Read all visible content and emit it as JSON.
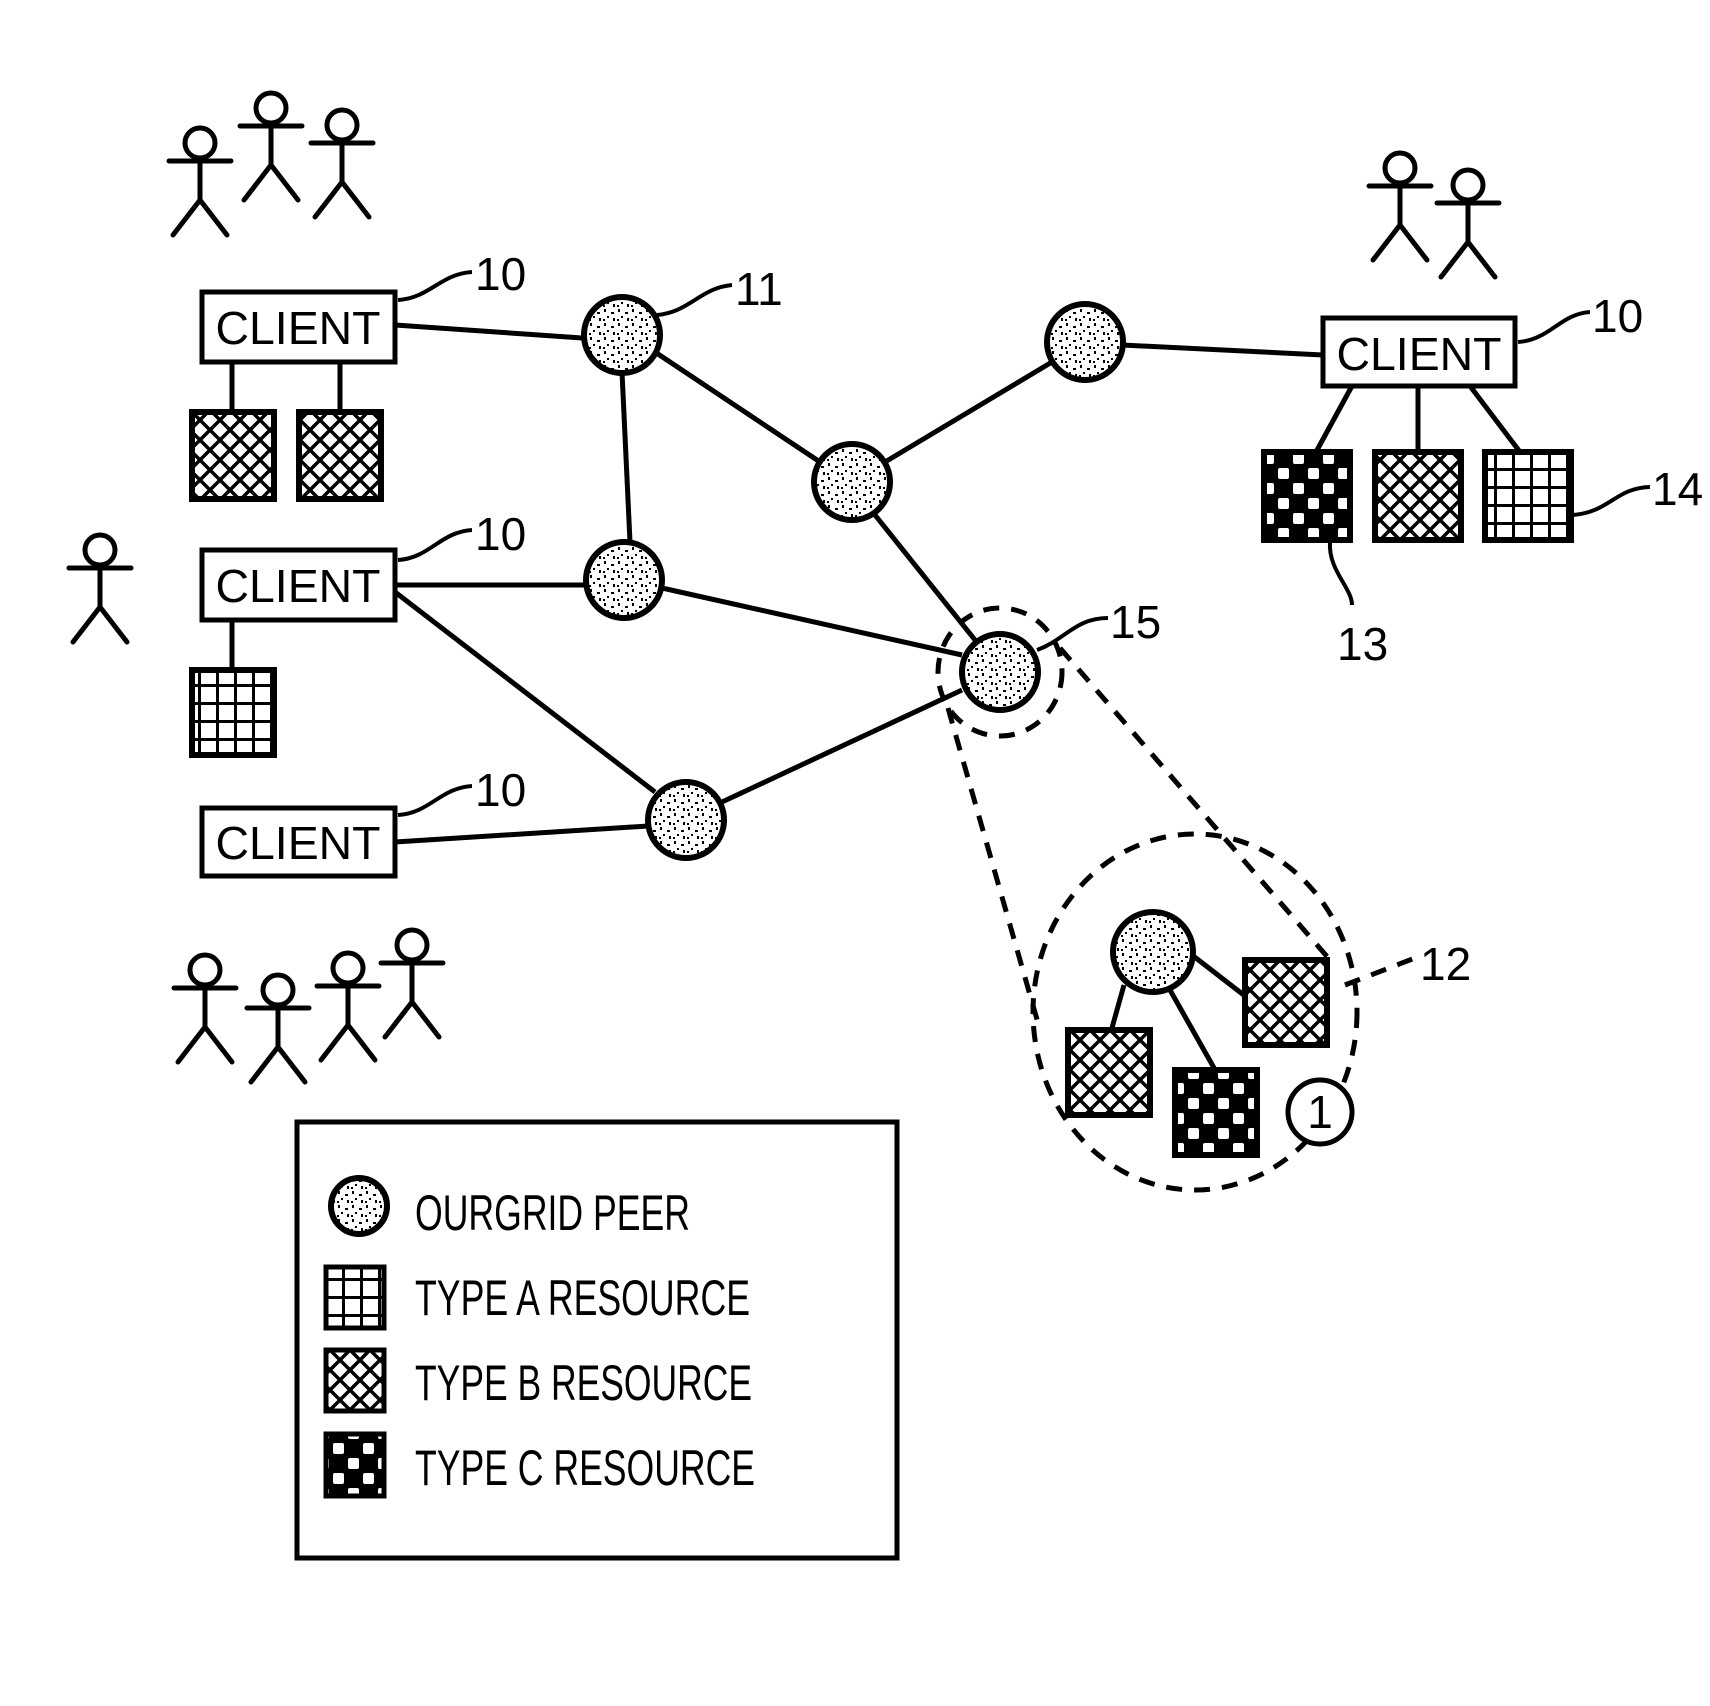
{
  "figure": {
    "clients": [
      {
        "label": "CLIENT",
        "ref": "10"
      },
      {
        "label": "CLIENT",
        "ref": "10"
      },
      {
        "label": "CLIENT",
        "ref": "10"
      },
      {
        "label": "CLIENT",
        "ref": "10"
      }
    ],
    "refs": {
      "peer": "11",
      "site": "12",
      "type_c_resource": "13",
      "type_a_resource": "14",
      "selected_peer": "15"
    },
    "site_badge": "1",
    "legend": {
      "items": [
        {
          "icon": "ourgrid-peer-icon",
          "label": "OURGRID PEER"
        },
        {
          "icon": "type-a-resource-icon",
          "label": "TYPE A RESOURCE"
        },
        {
          "icon": "type-b-resource-icon",
          "label": "TYPE B RESOURCE"
        },
        {
          "icon": "type-c-resource-icon",
          "label": "TYPE C RESOURCE"
        }
      ]
    },
    "colors": {
      "ink": "#000000",
      "paper": "#ffffff"
    }
  }
}
